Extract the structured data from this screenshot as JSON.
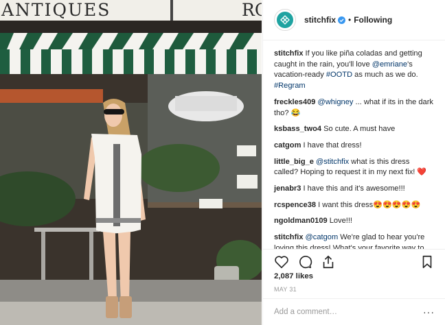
{
  "photo": {
    "sign_text_left": "ANTIQUES",
    "sign_text_right": "RC"
  },
  "header": {
    "username": "stitchfix",
    "separator": "•",
    "follow_label": "Following",
    "brand_color": "#1fa3a1"
  },
  "comments": [
    {
      "user": "stitchfix",
      "text": "If you like piña coladas and getting caught in the rain, you'll love ",
      "mention": "@emriane",
      "after": "'s vacation-ready ",
      "tag1": "#OOTD",
      "after2": " as much as we do. ",
      "tag2": "#Regram"
    },
    {
      "user": "freckles409",
      "mention": "@whigney",
      "text": " ... what if its in the dark tho? ",
      "emoji": "😂"
    },
    {
      "user": "ksbass_two4",
      "text": "So cute. A must have"
    },
    {
      "user": "catgom",
      "text": "I have that dress!"
    },
    {
      "user": "little_big_e",
      "mention": "@stitchfix",
      "text": " what is this dress called? Hoping to request it in my next fix! ",
      "emoji": "❤️"
    },
    {
      "user": "jenabr3",
      "text": "I have this and it's awesome!!!"
    },
    {
      "user": "rcspence38",
      "text": "I want this dress",
      "emoji": "😍😍😍😍😍"
    },
    {
      "user": "ngoldman0109",
      "text": "Love!!!"
    },
    {
      "user": "stitchfix",
      "mention": "@catgom",
      "text": " We're glad to hear you're loving this dress! What's your favorite way to style it?"
    }
  ],
  "actions": {
    "like_icon": "heart-icon",
    "comment_icon": "comment-icon",
    "share_icon": "share-icon",
    "save_icon": "bookmark-icon"
  },
  "likes": "2,087 likes",
  "date": "MAY 31",
  "comment_input": {
    "placeholder": "Add a comment…",
    "more_label": "···"
  }
}
